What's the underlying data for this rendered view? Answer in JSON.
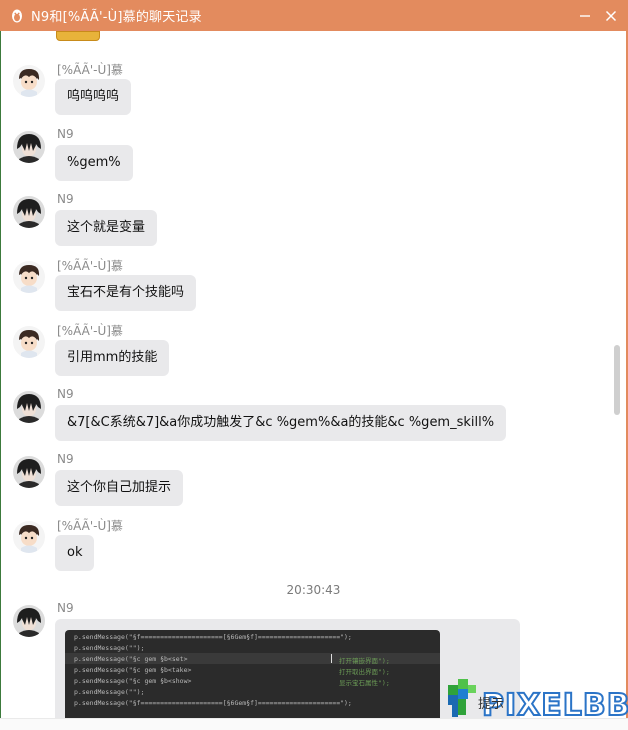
{
  "window": {
    "title": "N9和[%ÃÃ'-Ù]慕的聊天记录"
  },
  "users": {
    "n9": "N9",
    "other": "[%ÃÃ'-Ù]慕"
  },
  "messages": [
    {
      "sender": "[%ÃÃ'-Ù]慕",
      "text": "呜呜呜呜"
    },
    {
      "sender": "N9",
      "text": "%gem%"
    },
    {
      "sender": "N9",
      "text": "这个就是变量"
    },
    {
      "sender": "[%ÃÃ'-Ù]慕",
      "text": "宝石不是有个技能吗"
    },
    {
      "sender": "[%ÃÃ'-Ù]慕",
      "text": "引用mm的技能"
    },
    {
      "sender": "N9",
      "text": "&7[&C系统&7]&a你成功触发了&c %gem%&a的技能&c %gem_skill%"
    },
    {
      "sender": "N9",
      "text": "这个你自己加提示"
    },
    {
      "sender": "[%ÃÃ'-Ù]慕",
      "text": "ok"
    }
  ],
  "timestamp": "20:30:43",
  "last_message": {
    "sender": "N9",
    "code_lines": [
      {
        "code": "p.sendMessage(\"§f=====================[§6Gem§f]=====================\");",
        "comment": ""
      },
      {
        "code": "p.sendMessage(\"\");",
        "comment": ""
      },
      {
        "code": "p.sendMessage(\"§c     gem §b<set>",
        "comment": "打开镶嵌界面\");"
      },
      {
        "code": "p.sendMessage(\"§c     gem §b<take>",
        "comment": "打开取出界面\");"
      },
      {
        "code": "p.sendMessage(\"§c     gem §b<show>",
        "comment": "显示宝石属性\");"
      },
      {
        "code": "p.sendMessage(\"\");",
        "comment": ""
      },
      {
        "code": "p.sendMessage(\"§f=====================[§6Gem§f]=====================\");",
        "comment": ""
      }
    ]
  },
  "watermark": {
    "text": "PIXELBBS",
    "overlay_text": "提示"
  },
  "icons": {
    "app": "qq-penguin-icon",
    "minimize": "minimize-icon",
    "close": "close-icon"
  },
  "colors": {
    "titlebar": "#e38b5e",
    "bubble": "#e9e9eb",
    "code_bg": "#2b2b2b"
  }
}
